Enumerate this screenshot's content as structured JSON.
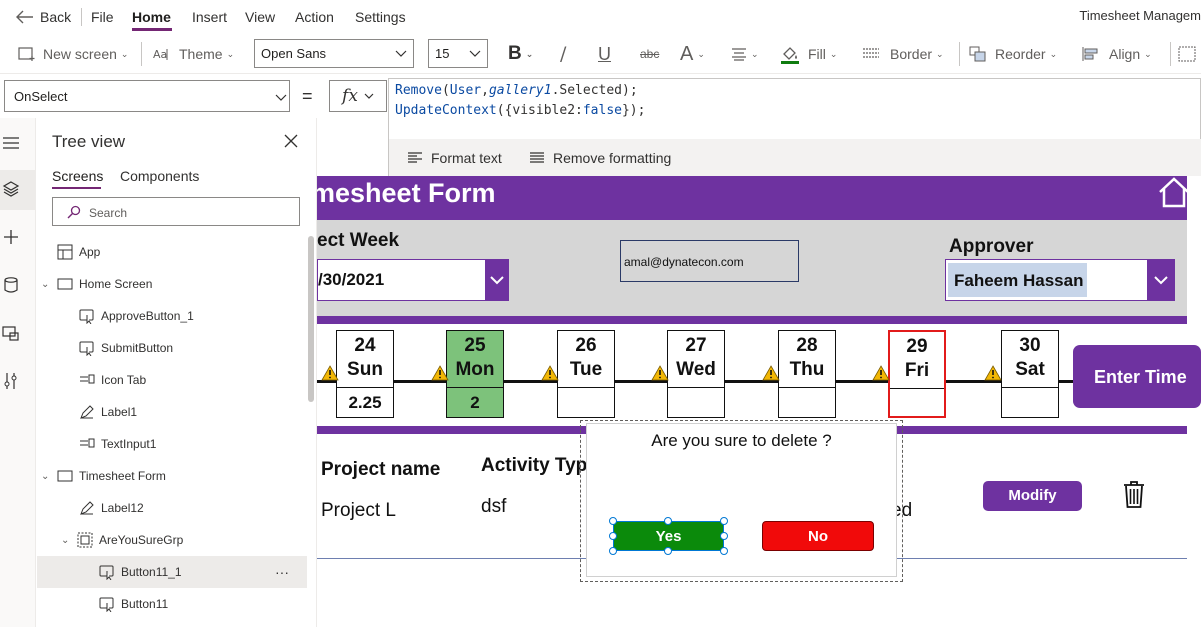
{
  "menubar": {
    "back_label": "Back",
    "items": [
      "File",
      "Home",
      "Insert",
      "View",
      "Action",
      "Settings"
    ],
    "app_title": "Timesheet Managem"
  },
  "toolbar": {
    "new_screen": "New screen",
    "theme": "Theme",
    "font": "Open Sans",
    "font_size": "15",
    "fill": "Fill",
    "border": "Border",
    "reorder": "Reorder",
    "align": "Align"
  },
  "formula": {
    "property": "OnSelect",
    "equals": "=",
    "fx": "fx",
    "line1": {
      "fn": "Remove",
      "open": "(",
      "arg1": "User",
      "comma": ",",
      "arg2": "gallery1",
      "rest": ".Selected);"
    },
    "line2": {
      "fn": "UpdateContext",
      "open": "({visible2:",
      "value": "false",
      "rest": "});"
    },
    "format_text": "Format text",
    "remove_formatting": "Remove formatting"
  },
  "treeview": {
    "title": "Tree view",
    "tabs": [
      "Screens",
      "Components"
    ],
    "search_placeholder": "Search",
    "items": [
      {
        "label": "App",
        "icon": "app-icon"
      },
      {
        "label": "Home Screen",
        "icon": "screen-icon"
      },
      {
        "label": "ApproveButton_1",
        "icon": "button-icon"
      },
      {
        "label": "SubmitButton",
        "icon": "button-icon"
      },
      {
        "label": "Icon Tab",
        "icon": "icon-control-icon"
      },
      {
        "label": "Label1",
        "icon": "label-icon"
      },
      {
        "label": "TextInput1",
        "icon": "textinput-icon"
      },
      {
        "label": "Timesheet Form",
        "icon": "screen-icon"
      },
      {
        "label": "Label12",
        "icon": "label-icon"
      },
      {
        "label": "AreYouSureGrp",
        "icon": "group-icon"
      },
      {
        "label": "Button11_1",
        "icon": "button-icon"
      },
      {
        "label": "Button11",
        "icon": "button-icon"
      }
    ],
    "more": "···"
  },
  "canvas": {
    "form_title": "mesheet Form",
    "select_week_label": "ect Week",
    "date_value": "/30/2021",
    "email": "amal@dynatecon.com",
    "approver_label": "Approver",
    "approver_value": "Faheem Hassan",
    "days": [
      {
        "num": "24",
        "name": "Sun",
        "hours": "2.25"
      },
      {
        "num": "25",
        "name": "Mon",
        "hours": "2"
      },
      {
        "num": "26",
        "name": "Tue",
        "hours": ""
      },
      {
        "num": "27",
        "name": "Wed",
        "hours": ""
      },
      {
        "num": "28",
        "name": "Thu",
        "hours": ""
      },
      {
        "num": "29",
        "name": "Fri",
        "hours": ""
      },
      {
        "num": "30",
        "name": "Sat",
        "hours": ""
      }
    ],
    "enter_time": "Enter Time",
    "gallery": {
      "col_project": "Project name",
      "col_activity": "Activity Typ",
      "project": "Project L",
      "activity": "dsf",
      "status_partial": "ed",
      "modify": "Modify"
    },
    "dialog": {
      "message": "Are you sure to delete ?",
      "yes": "Yes",
      "no": "No"
    }
  },
  "colors": {
    "accent": "#742774",
    "form_purple": "#6e32a0",
    "yes_green": "#0b8a0b",
    "no_red": "#f10a0a",
    "today_green": "#7dc27b",
    "selected_day_border": "#e21b1b"
  }
}
